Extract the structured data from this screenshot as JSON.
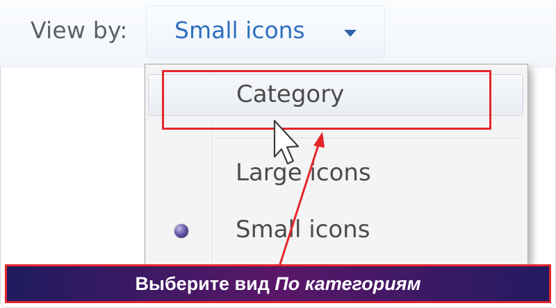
{
  "toolbar": {
    "view_by_label": "View by:",
    "view_by_value": "Small icons"
  },
  "menu": {
    "items": [
      {
        "label": "Category",
        "highlighted": true
      },
      {
        "label": "Large icons",
        "selected": false
      },
      {
        "label": "Small icons",
        "selected": true
      }
    ]
  },
  "banner": {
    "text_plain": "Выберите вид ",
    "text_emphasis": "По категориям"
  },
  "colors": {
    "annotation_red": "#e5252a",
    "link_blue": "#2e6fbf",
    "banner_purple": "#5a1769"
  },
  "icons": {
    "dropdown": "chevron-down-icon",
    "cursor": "mouse-pointer-icon",
    "radio": "radio-bullet-icon",
    "annotation": "arrow-icon"
  }
}
